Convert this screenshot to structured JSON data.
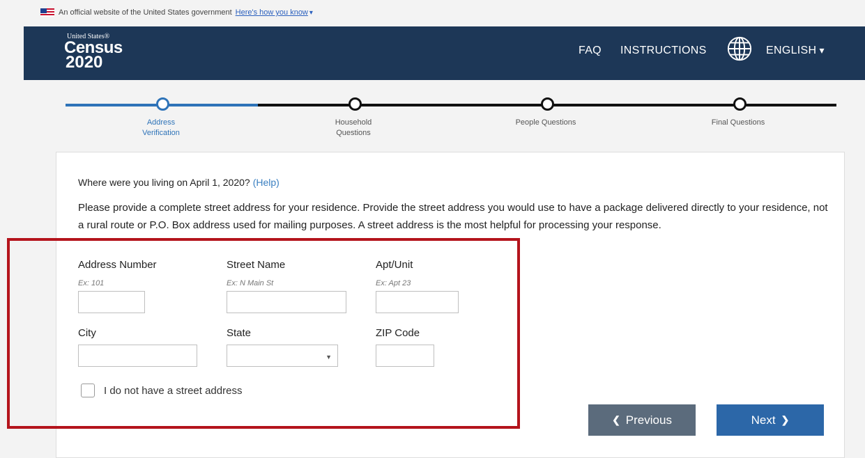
{
  "gov_banner": {
    "text": "An official website of the United States government",
    "link": "Here's how you know"
  },
  "header": {
    "logo": {
      "top": "United States®",
      "name": "Census",
      "year": "2020"
    },
    "nav": {
      "faq": "FAQ",
      "instructions": "INSTRUCTIONS",
      "language": "ENGLISH"
    },
    "colors": {
      "background": "#1d3757"
    }
  },
  "progress": {
    "steps": [
      {
        "label_line1": "Address",
        "label_line2": "Verification",
        "status": "active"
      },
      {
        "label_line1": "Household",
        "label_line2": "Questions",
        "status": "todo"
      },
      {
        "label_line1": "People Questions",
        "label_line2": "",
        "status": "todo"
      },
      {
        "label_line1": "Final Questions",
        "label_line2": "",
        "status": "todo"
      }
    ],
    "colors": {
      "active": "#2e73b8",
      "todo": "#111111"
    }
  },
  "form": {
    "question": "Where were you living on April 1, 2020?",
    "help_link": "(Help)",
    "instructions": "Please provide a complete street address for your residence. Provide the street address you would use to have a package delivered directly to your residence, not a rural route or P.O. Box address used for mailing purposes. A street address is the most helpful for processing your response.",
    "fields": {
      "address_number": {
        "label": "Address Number",
        "hint": "Ex: 101",
        "value": ""
      },
      "street_name": {
        "label": "Street Name",
        "hint": "Ex: N Main St",
        "value": ""
      },
      "apt_unit": {
        "label": "Apt/Unit",
        "hint": "Ex: Apt 23",
        "value": ""
      },
      "city": {
        "label": "City",
        "value": ""
      },
      "state": {
        "label": "State",
        "value": ""
      },
      "zip": {
        "label": "ZIP Code",
        "value": ""
      }
    },
    "no_street_address": {
      "label": "I do not have a street address",
      "checked": false
    }
  },
  "buttons": {
    "previous": "Previous",
    "next": "Next"
  },
  "colors": {
    "highlight_box": "#b4141c",
    "prev_button": "#5b6b7c",
    "next_button": "#2c67a8",
    "link": "#3a7fc1"
  }
}
